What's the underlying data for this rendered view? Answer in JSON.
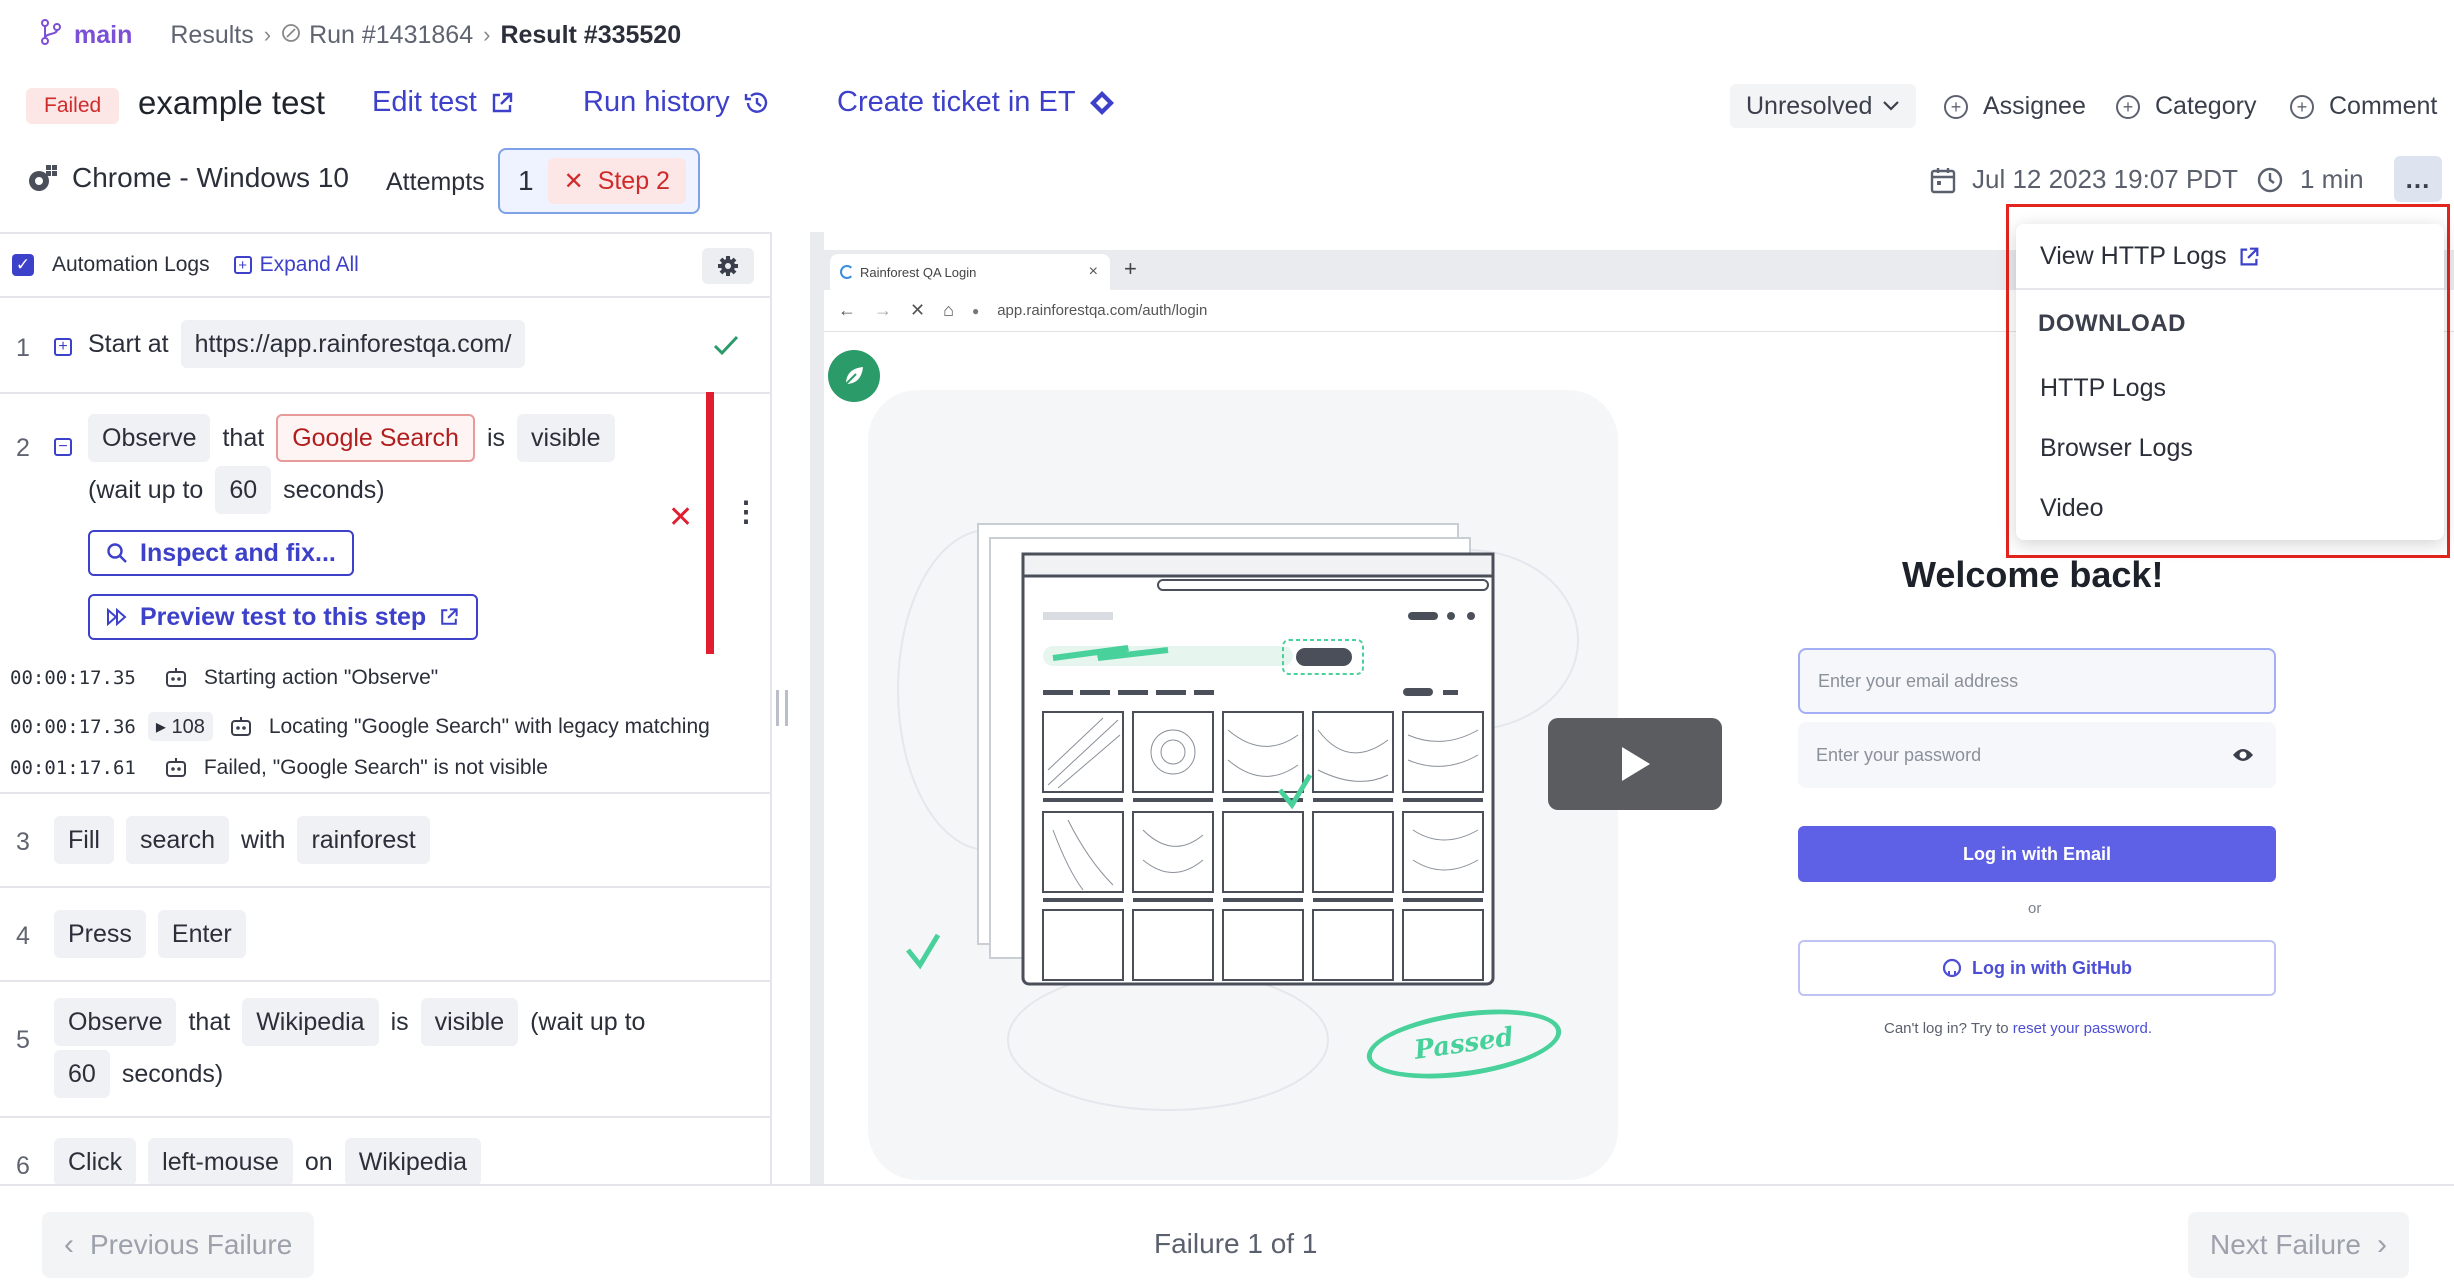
{
  "breadcrumb": {
    "branch": "main",
    "results": "Results",
    "run": "Run #1431864",
    "result": "Result #335520"
  },
  "header": {
    "status": "Failed",
    "test_name": "example test",
    "edit_test": "Edit test",
    "run_history": "Run history",
    "create_ticket": "Create ticket in ET",
    "resolution": "Unresolved",
    "assignee": "Assignee",
    "category": "Category",
    "comment": "Comment"
  },
  "env": {
    "browser": "Chrome - Windows 10",
    "attempts_label": "Attempts",
    "attempt_number": "1",
    "attempt_step": "Step 2",
    "date": "Jul 12 2023 19:07 PDT",
    "duration": "1 min",
    "more": "..."
  },
  "logs_panel": {
    "automation_logs": "Automation Logs",
    "expand_all": "Expand All"
  },
  "steps": [
    {
      "num": "1",
      "words": {
        "start": "Start at",
        "url": "https://app.rainforestqa.com/"
      }
    },
    {
      "num": "2",
      "words": {
        "observe": "Observe",
        "that": "that",
        "target": "Google Search",
        "is": "is",
        "visible": "visible",
        "wait": "(wait up to",
        "secs": "60",
        "seconds": "seconds)"
      }
    },
    {
      "num": "3",
      "words": {
        "fill": "Fill",
        "search": "search",
        "with": "with",
        "value": "rainforest"
      }
    },
    {
      "num": "4",
      "words": {
        "press": "Press",
        "key": "Enter"
      }
    },
    {
      "num": "5",
      "words": {
        "observe": "Observe",
        "that": "that",
        "target": "Wikipedia",
        "is": "is",
        "visible": "visible",
        "wait": "(wait up to",
        "secs": "60",
        "seconds": "seconds)"
      }
    },
    {
      "num": "6",
      "words": {
        "click": "Click",
        "button": "left-mouse",
        "on": "on",
        "target": "Wikipedia"
      }
    }
  ],
  "step2_actions": {
    "inspect": "Inspect and fix...",
    "preview": "Preview test to this step"
  },
  "step2_logs": [
    {
      "time": "00:00:17.35",
      "msg": "Starting action \"Observe\""
    },
    {
      "time": "00:00:17.36",
      "count": "108",
      "msg": "Locating \"Google Search\" with legacy matching"
    },
    {
      "time": "00:01:17.61",
      "msg": "Failed, \"Google Search\" is not visible"
    }
  ],
  "screenshot": {
    "tab_title": "Rainforest QA Login",
    "url": "app.rainforestqa.com/auth/login",
    "passed": "Passed",
    "welcome": "Welcome back!",
    "email_placeholder": "Enter your email address",
    "password_placeholder": "Enter your password",
    "login_email": "Log in with Email",
    "or": "or",
    "login_github": "Log in with GitHub",
    "cant_login": "Can't log in? Try to",
    "reset": "reset your password."
  },
  "menu": {
    "view_http_logs": "View HTTP Logs",
    "download_heading": "DOWNLOAD",
    "http_logs": "HTTP Logs",
    "browser_logs": "Browser Logs",
    "video": "Video"
  },
  "footer": {
    "previous": "Previous Failure",
    "position": "Failure 1 of 1",
    "next": "Next Failure"
  },
  "colors": {
    "accent": "#3d40c9",
    "failed": "#cf2b2b",
    "success": "#2a9b69",
    "highlight": "#e2251d"
  }
}
